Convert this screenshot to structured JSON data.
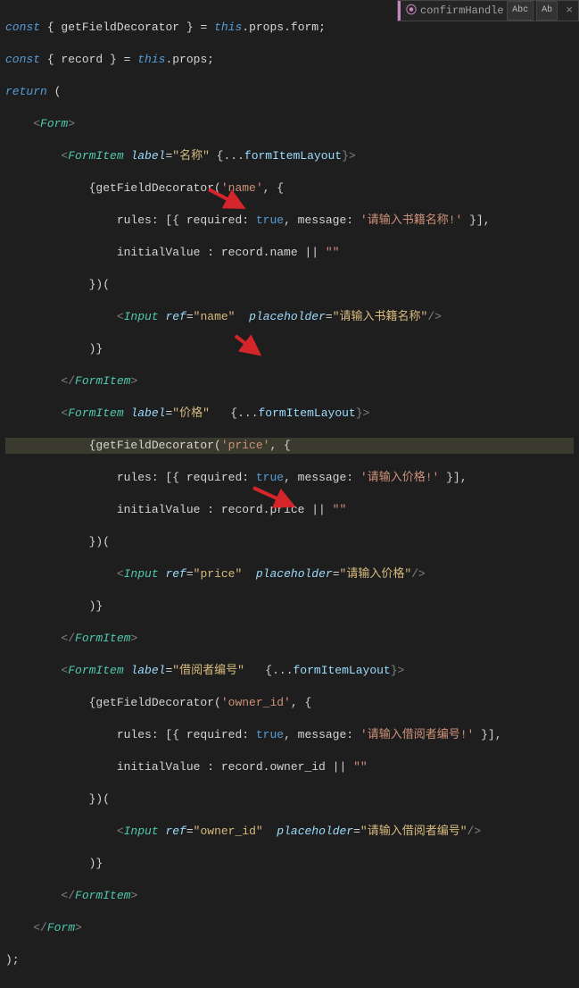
{
  "popup": {
    "method": "confirmHandle",
    "abc": "Abc",
    "ab": "Ab"
  },
  "code": {
    "l1a": "const",
    "l1b": " { getFieldDecorator } = ",
    "l1c": "this",
    "l1d": ".props.form;",
    "l2a": "const",
    "l2b": " { record } = ",
    "l2c": "this",
    "l2d": ".props;",
    "l3a": "return",
    "l3b": " (",
    "l4a": "    <",
    "l4b": "Form",
    "l4c": ">",
    "l5a": "        <",
    "l5b": "FormItem",
    "l5c": " label",
    "l5d": "=",
    "l5e": "\"名称\"",
    "l5f": " {",
    "l5g": "...",
    "l5h": "formItemLayout",
    "l5i": "}>",
    "l6a": "            {getFieldDecorator(",
    "l6b": "'name'",
    "l6c": ", {",
    "l7a": "                rules: [{ required: ",
    "l7b": "true",
    "l7c": ", message: ",
    "l7d": "'请输入书籍名称!'",
    "l7e": " }],",
    "l8a": "                initialValue : record.name || ",
    "l8b": "\"\"",
    "l9a": "            })(",
    "l10a": "                <",
    "l10b": "Input",
    "l10c": " ref",
    "l10d": "=",
    "l10e": "\"name\"",
    "l10f": "  placeholder",
    "l10g": "=",
    "l10h": "\"请输入书籍名称\"",
    "l10i": "/>",
    "l11a": "            )}",
    "l12a": "        </",
    "l12b": "FormItem",
    "l12c": ">",
    "l13a": "        <",
    "l13b": "FormItem",
    "l13c": " label",
    "l13d": "=",
    "l13e": "\"价格\"",
    "l13f": "   {",
    "l13g": "...",
    "l13h": "formItemLayout",
    "l13i": "}>",
    "l14a": "            {getFieldDecorator(",
    "l14b": "'price'",
    "l14c": ", {",
    "l15a": "                rules: [{ required: ",
    "l15b": "true",
    "l15c": ", message: ",
    "l15d": "'请输入价格!'",
    "l15e": " }],",
    "l16a": "                initialValue : record.price || ",
    "l16b": "\"\"",
    "l17a": "            })(",
    "l18a": "                <",
    "l18b": "Input",
    "l18c": " ref",
    "l18d": "=",
    "l18e": "\"price\"",
    "l18f": "  placeholder",
    "l18g": "=",
    "l18h": "\"请输入价格\"",
    "l18i": "/>",
    "l19a": "            )}",
    "l20a": "        </",
    "l20b": "FormItem",
    "l20c": ">",
    "l21a": "        <",
    "l21b": "FormItem",
    "l21c": " label",
    "l21d": "=",
    "l21e": "\"借阅者编号\"",
    "l21f": "   {",
    "l21g": "...",
    "l21h": "formItemLayout",
    "l21i": "}>",
    "l22a": "            {getFieldDecorator(",
    "l22b": "'owner_id'",
    "l22c": ", {",
    "l23a": "                rules: [{ required: ",
    "l23b": "true",
    "l23c": ", message: ",
    "l23d": "'请输入借阅者编号!'",
    "l23e": " }],",
    "l24a": "                initialValue : record.owner_id || ",
    "l24b": "\"\"",
    "l25a": "            })(",
    "l26a": "                <",
    "l26b": "Input",
    "l26c": " ref",
    "l26d": "=",
    "l26e": "\"owner_id\"",
    "l26f": "  placeholder",
    "l26g": "=",
    "l26h": "\"请输入借阅者编号\"",
    "l26i": "/>",
    "l27a": "            )}",
    "l28a": "        </",
    "l28b": "FormItem",
    "l28c": ">",
    "l29a": "    </",
    "l29b": "Form",
    "l29c": ">",
    "l30a": ");"
  }
}
